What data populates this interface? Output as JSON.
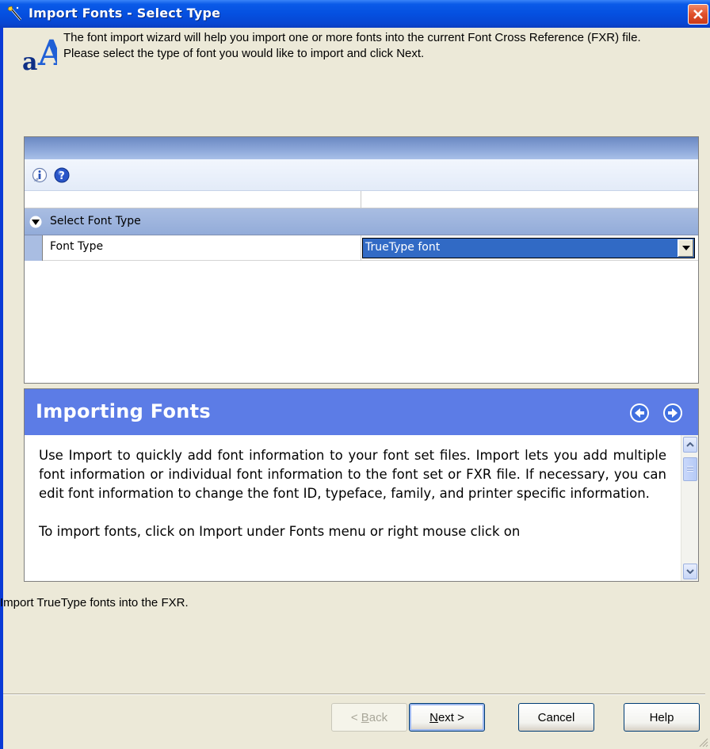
{
  "window": {
    "title": "Import Fonts - Select Type",
    "icon": "wand-icon",
    "close_icon": "close-icon"
  },
  "header": {
    "icon": "font-aa-icon",
    "line1": "The font import wizard will help you import one or more fonts into the current Font Cross Reference (FXR) file.",
    "line2": "Please select the type of font you would like to import and click Next."
  },
  "property_grid": {
    "toolbar": [
      {
        "name": "info-icon",
        "tooltip": ""
      },
      {
        "name": "help-icon",
        "tooltip": ""
      }
    ],
    "category": "Select Font Type",
    "property": {
      "name": "Font Type",
      "value": "TrueType font"
    }
  },
  "help": {
    "title": "Importing Fonts",
    "paragraph1": "Use Import to quickly add font information to your font set files. Import lets you add multiple font information or individual font information to the font set or FXR file. If necessary, you can edit font information to change the font ID, typeface, family, and printer specific information.",
    "paragraph2": "To import fonts, click on Import under Fonts menu or right mouse click on",
    "nav": {
      "back_icon": "back-arrow-icon",
      "forward_icon": "forward-arrow-icon"
    }
  },
  "status": "Import TrueType fonts into the FXR.",
  "buttons": {
    "back": {
      "prefix": "< ",
      "accel": "B",
      "rest": "ack",
      "enabled": false
    },
    "next": {
      "accel": "N",
      "rest": "ext >",
      "enabled": true
    },
    "cancel": "Cancel",
    "help": "Help"
  },
  "colors": {
    "titlebar": "#0550e0",
    "dialog_bg": "#ece9d8",
    "help_header": "#5c7ce6",
    "selection": "#316ac5"
  }
}
